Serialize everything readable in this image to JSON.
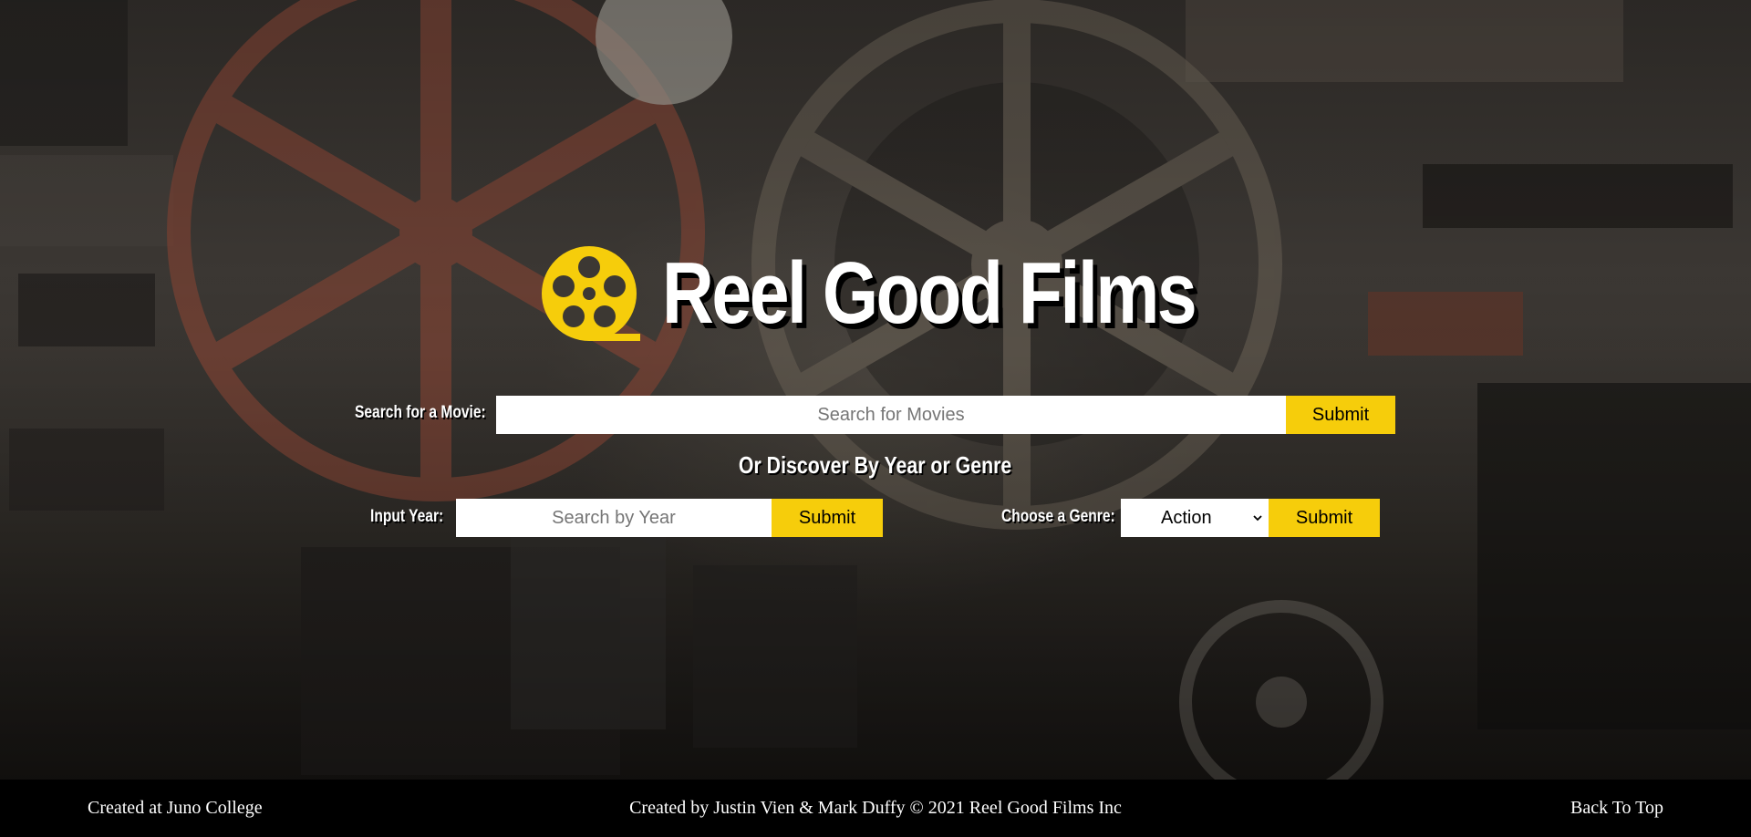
{
  "header": {
    "title": "Reel Good Films",
    "logo_icon": "film-reel-icon",
    "accent_color": "#f6cd0b"
  },
  "search": {
    "label": "Search for a Movie:",
    "placeholder": "Search for Movies",
    "submit_label": "Submit"
  },
  "discover": {
    "heading": "Or Discover By Year or Genre"
  },
  "year": {
    "label": "Input Year:",
    "placeholder": "Search by Year",
    "submit_label": "Submit"
  },
  "genre": {
    "label": "Choose a Genre:",
    "selected": "Action",
    "dropdown_icon": "chevron-down-icon",
    "submit_label": "Submit"
  },
  "footer": {
    "left": "Created at Juno College",
    "center": "Created by Justin Vien & Mark Duffy © 2021 Reel Good Films Inc",
    "back_to_top": "Back To Top"
  }
}
